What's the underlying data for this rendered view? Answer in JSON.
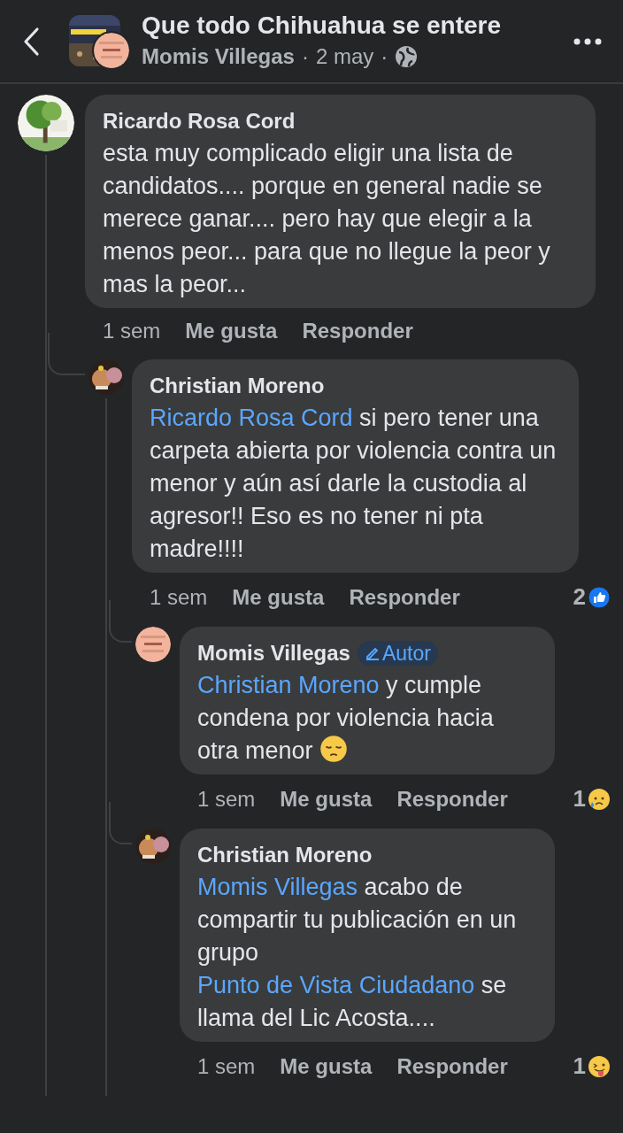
{
  "header": {
    "title": "Que todo Chihuahua se entere",
    "author": "Momis Villegas",
    "date": "2 may",
    "separator": "·"
  },
  "comments": [
    {
      "name": "Ricardo Rosa Cord",
      "body": [
        {
          "kind": "text",
          "text": "esta muy complicado eligir una lista de candidatos.... porque en general nadie se merece ganar.... pero hay que elegir a la menos peor... para que no llegue la peor y mas la peor..."
        }
      ],
      "time": "1 sem",
      "like": "Me gusta",
      "reply": "Responder",
      "children": [
        {
          "name": "Christian Moreno",
          "body": [
            {
              "kind": "mention",
              "text": "Ricardo Rosa Cord"
            },
            {
              "kind": "text",
              "text": " si pero tener una carpeta abierta por violencia contra un menor y aún así darle la custodia al agresor!! Eso es no tener ni pta madre!!!!"
            }
          ],
          "time": "1 sem",
          "like": "Me gusta",
          "reply": "Responder",
          "reaction": {
            "count": "2",
            "kind": "like"
          },
          "children": [
            {
              "name": "Momis Villegas",
              "badge": "Autor",
              "body": [
                {
                  "kind": "mention",
                  "text": "Christian Moreno"
                },
                {
                  "kind": "text",
                  "text": " y cumple condena por violencia hacia otra menor "
                },
                {
                  "kind": "emoji"
                }
              ],
              "time": "1 sem",
              "like": "Me gusta",
              "reply": "Responder",
              "reaction": {
                "count": "1",
                "kind": "sad"
              }
            },
            {
              "name": "Christian Moreno",
              "body": [
                {
                  "kind": "mention",
                  "text": "Momis Villegas"
                },
                {
                  "kind": "text",
                  "text": " acabo de compartir tu publicación en un grupo "
                },
                {
                  "kind": "mention",
                  "text": "Punto de Vista Ciudadano"
                },
                {
                  "kind": "text",
                  "text": "  se llama del Lic Acosta...."
                }
              ],
              "time": "1 sem",
              "like": "Me gusta",
              "reply": "Responder",
              "reaction": {
                "count": "1",
                "kind": "tongue"
              }
            }
          ]
        }
      ]
    }
  ]
}
